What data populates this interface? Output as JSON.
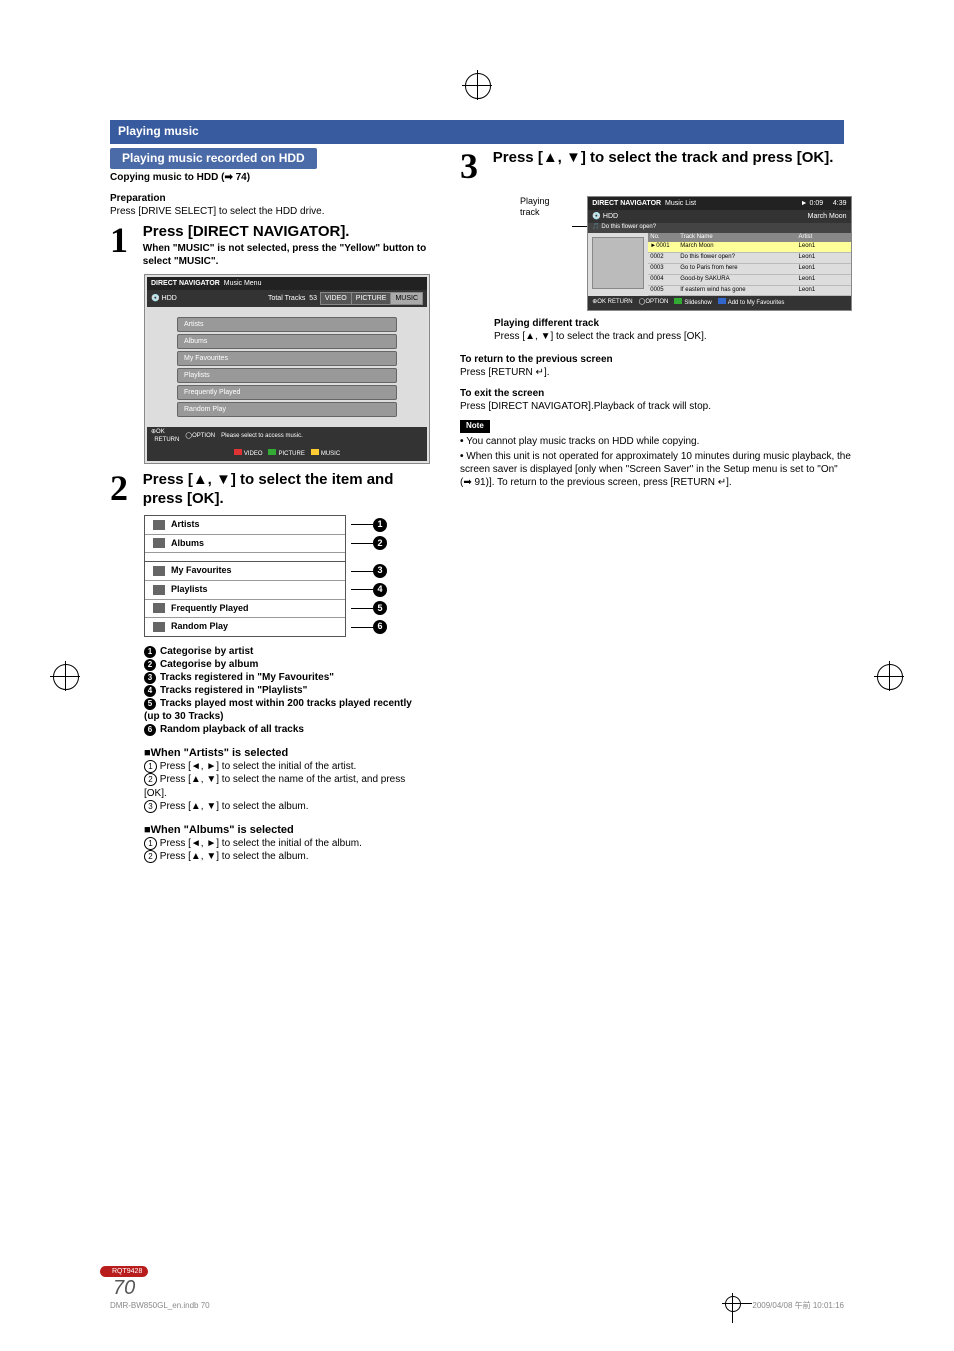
{
  "header": {
    "title": "Playing music"
  },
  "section_bar": "Playing music recorded on HDD",
  "copying_line": "Copying music to HDD (➡ 74)",
  "preparation_label": "Preparation",
  "preparation_text": "Press [DRIVE SELECT] to select the HDD drive.",
  "steps": {
    "s1": {
      "num": "1",
      "heading": "Press [DIRECT NAVIGATOR].",
      "sub": "When \"MUSIC\" is not selected, press the \"Yellow\" button to select \"MUSIC\"."
    },
    "s2": {
      "num": "2",
      "heading": "Press [▲, ▼] to select the item and press [OK]."
    },
    "s3": {
      "num": "3",
      "heading": "Press [▲, ▼] to select the track and press [OK]."
    }
  },
  "mock_nav": {
    "title": "DIRECT NAVIGATOR",
    "subtitle": "Music Menu",
    "drive": "HDD",
    "total_label": "Total Tracks",
    "total_value": "53",
    "tabs": [
      "VIDEO",
      "PICTURE",
      "MUSIC"
    ],
    "menu": [
      "Artists",
      "Albums",
      "My Favourites",
      "Playlists",
      "Frequently Played",
      "Random Play"
    ],
    "footer": {
      "ok": "OK",
      "return": "RETURN",
      "option": "OPTION",
      "hint": "Please select to access music.",
      "red": "VIDEO",
      "green": "PICTURE",
      "yellow": "MUSIC"
    }
  },
  "item_list": [
    "Artists",
    "Albums",
    "My Favourites",
    "Playlists",
    "Frequently Played",
    "Random Play"
  ],
  "item_expl": [
    "Categorise by artist",
    "Categorise by album",
    "Tracks registered in \"My Favourites\"",
    "Tracks registered in \"Playlists\"",
    "Tracks played most within 200 tracks played recently (up to 30 Tracks)",
    "Random playback of all tracks"
  ],
  "artists_section": {
    "title": "When \"Artists\" is selected",
    "lines": [
      "Press [◄, ►] to select the initial of the artist.",
      "Press [▲, ▼] to select the name of the artist, and press [OK].",
      "Press [▲, ▼] to select the album."
    ]
  },
  "albums_section": {
    "title": "When \"Albums\" is selected",
    "lines": [
      "Press [◄, ►] to select the initial of the album.",
      "Press [▲, ▼] to select the album."
    ]
  },
  "right": {
    "playing_track_label": "Playing track",
    "tracklist": {
      "title": "DIRECT NAVIGATOR",
      "subtitle": "Music List",
      "drive": "HDD",
      "time_elapsed": "0:09",
      "time_total": "4:39",
      "group": "Do this flower open?",
      "group_artist": "March Moon",
      "cols": {
        "no": "No.",
        "name": "Track Name",
        "artist": "Artist"
      },
      "rows": [
        {
          "no": "0001",
          "name": "March Moon",
          "artist": "Leon1"
        },
        {
          "no": "0002",
          "name": "Do this flower open?",
          "artist": "Leon1"
        },
        {
          "no": "0003",
          "name": "Go to Paris from here",
          "artist": "Leon1"
        },
        {
          "no": "0004",
          "name": "Good-by SAKURA",
          "artist": "Leon1"
        },
        {
          "no": "0005",
          "name": "If eastern wind has gone",
          "artist": "Leon1"
        }
      ],
      "footer": {
        "ok": "OK",
        "return": "RETURN",
        "option": "OPTION",
        "green": "Slideshow",
        "blue": "Add to My Favourites"
      }
    },
    "diff_track_h": "Playing different track",
    "diff_track_t": "Press [▲, ▼] to select the track and press [OK].",
    "return_h": "To return to the previous screen",
    "return_t": "Press [RETURN ↵].",
    "exit_h": "To exit the screen",
    "exit_t": "Press [DIRECT NAVIGATOR].Playback of track will stop.",
    "note_label": "Note",
    "notes": [
      "You cannot play music tracks on HDD while copying.",
      "When this unit is not operated for approximately 10 minutes during music playback, the screen saver is displayed [only when \"Screen Saver\" in the Setup menu is set to \"On\" (➡ 91)]. To return to the previous screen, press [RETURN ↵]."
    ]
  },
  "footer": {
    "code": "RQT9428",
    "page": "70",
    "file": "DMR-BW850GL_en.indb   70",
    "timestamp": "2009/04/08   午前 10:01:16"
  }
}
